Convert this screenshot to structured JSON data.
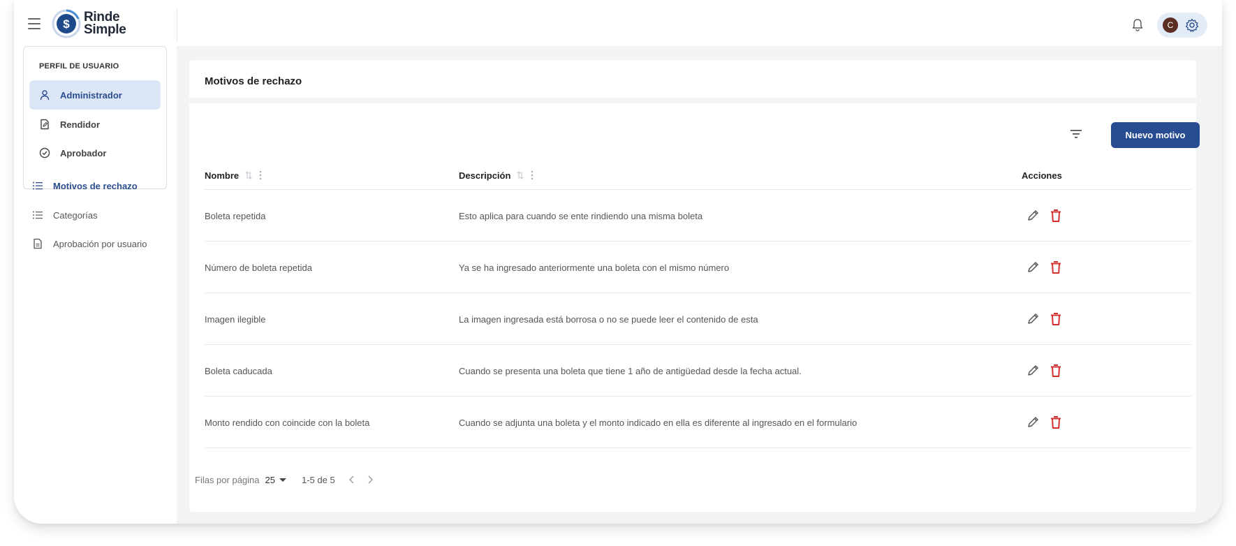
{
  "header": {
    "brand_line1": "Rinde",
    "brand_line2": "Simple",
    "avatar_initial": "C",
    "icons": {
      "menu": "menu-icon",
      "bell": "bell-icon",
      "gear": "gear-icon"
    }
  },
  "sidebar": {
    "profile_title": "PERFIL DE USUARIO",
    "roles": [
      {
        "label": "Administrador",
        "icon": "user-icon",
        "active": true
      },
      {
        "label": "Rendidor",
        "icon": "document-edit-icon",
        "active": false
      },
      {
        "label": "Aprobador",
        "icon": "check-circle-icon",
        "active": false
      }
    ],
    "nav": [
      {
        "label": "Motivos de rechazo",
        "icon": "list-icon",
        "active": true
      },
      {
        "label": "Categorías",
        "icon": "list-icon",
        "active": false
      },
      {
        "label": "Aprobación por usuario",
        "icon": "document-icon",
        "active": false
      }
    ]
  },
  "main": {
    "title": "Motivos de rechazo",
    "new_button": "Nuevo motivo",
    "columns": {
      "name": "Nombre",
      "description": "Descripción",
      "actions": "Acciones"
    },
    "rows": [
      {
        "name": "Boleta repetida",
        "description": "Esto aplica para cuando se ente rindiendo una misma boleta"
      },
      {
        "name": "Número de boleta repetida",
        "description": "Ya se ha ingresado anteriormente una boleta con el mismo número"
      },
      {
        "name": "Imagen ilegible",
        "description": "La imagen ingresada está borrosa o no se puede leer el contenido de esta"
      },
      {
        "name": "Boleta caducada",
        "description": "Cuando se presenta una boleta que tiene 1 año de antigüedad desde la fecha actual."
      },
      {
        "name": "Monto rendido con coincide con la boleta",
        "description": "Cuando se adjunta una boleta y el monto indicado en ella es diferente al ingresado en el formulario"
      }
    ],
    "pagination": {
      "rows_per_page_label": "Filas por página",
      "rows_per_page": "25",
      "range": "1-5 de 5"
    }
  },
  "colors": {
    "primary": "#284c91",
    "active_bg": "#dce6f6",
    "danger": "#d32f2f",
    "page_bg": "#f2f3f5"
  }
}
